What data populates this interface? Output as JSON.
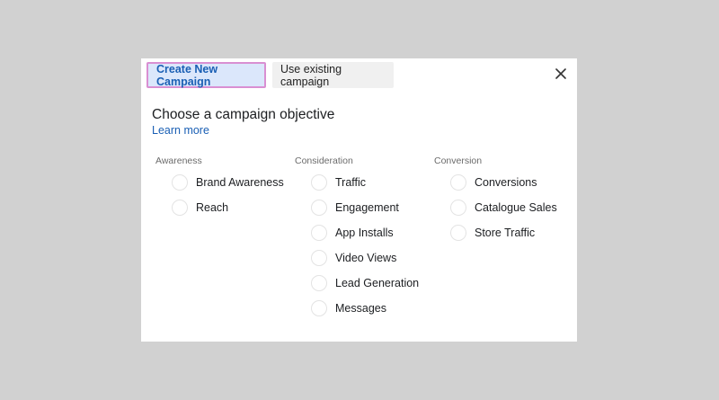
{
  "tabs": [
    {
      "label": "Create New Campaign"
    },
    {
      "label": "Use existing campaign"
    }
  ],
  "close_icon": "close-icon",
  "heading": "Choose a campaign objective",
  "learn_more": "Learn more",
  "columns": [
    {
      "title": "Awareness",
      "options": [
        "Brand Awareness",
        "Reach"
      ]
    },
    {
      "title": "Consideration",
      "options": [
        "Traffic",
        "Engagement",
        "App Installs",
        "Video Views",
        "Lead Generation",
        "Messages"
      ]
    },
    {
      "title": "Conversion",
      "options": [
        "Conversions",
        "Catalogue Sales",
        "Store Traffic"
      ]
    }
  ],
  "colors": {
    "accent": "#1a5fb4",
    "active_tab_bg": "#dbe7fb",
    "active_tab_border": "#d98fd2",
    "backdrop": "#d1d1d1"
  }
}
